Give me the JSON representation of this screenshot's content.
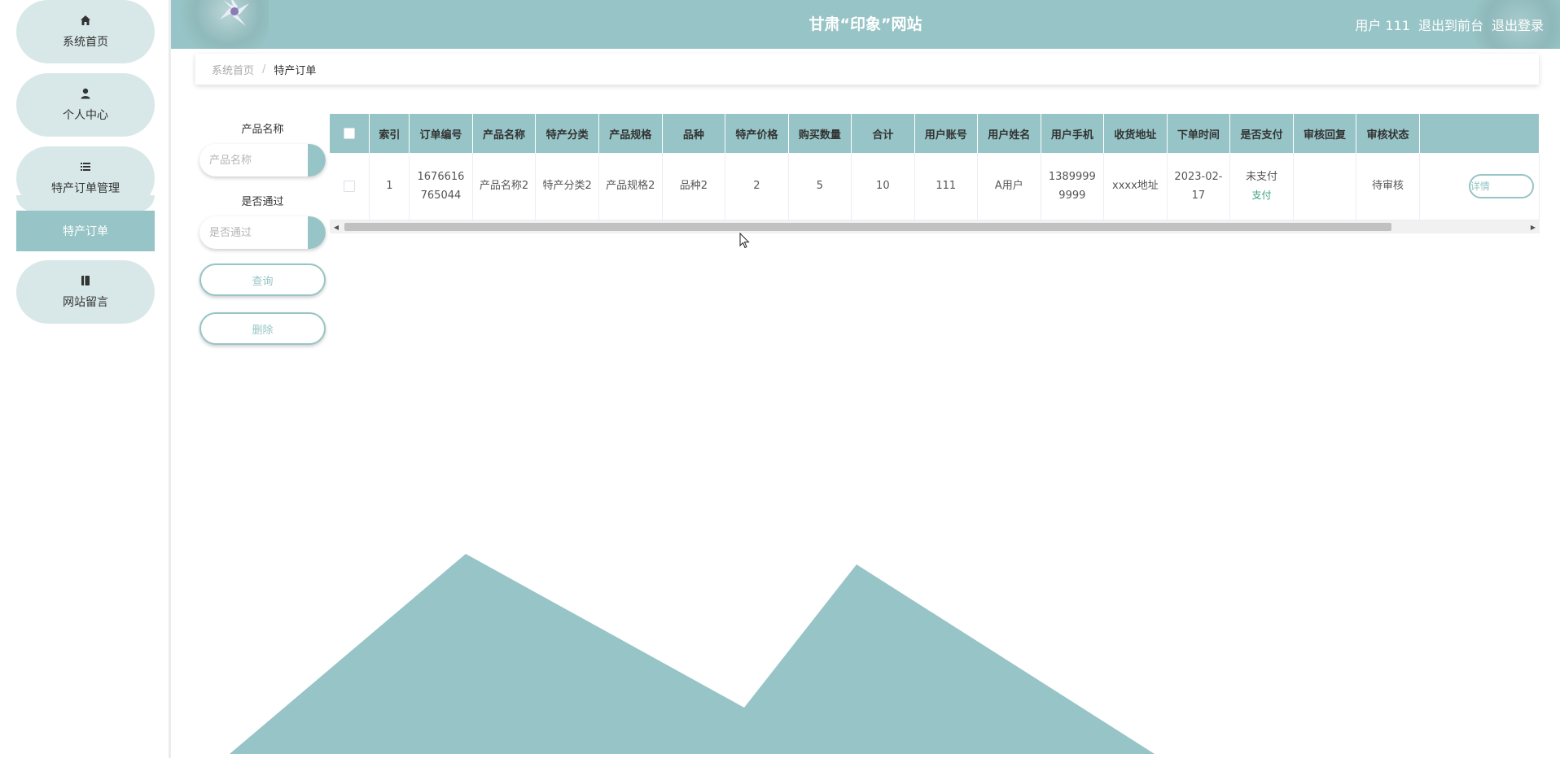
{
  "header": {
    "title": "甘肃“印象”网站",
    "user_label": "用户 111",
    "back_front": "退出到前台",
    "logout": "退出登录"
  },
  "sidebar": {
    "items": [
      {
        "label": "系统首页",
        "icon": "home-icon"
      },
      {
        "label": "个人中心",
        "icon": "user-icon"
      },
      {
        "label": "特产订单管理",
        "icon": "list-icon"
      },
      {
        "label": "网站留言",
        "icon": "book-icon"
      }
    ],
    "sub_item": "特产订单"
  },
  "breadcrumb": {
    "home": "系统首页",
    "separator": "/",
    "current": "特产订单"
  },
  "search": {
    "product_label": "产品名称",
    "product_placeholder": "产品名称",
    "pass_label": "是否通过",
    "pass_placeholder": "是否通过",
    "query_button": "查询",
    "delete_button": "删除"
  },
  "table": {
    "columns": [
      "索引",
      "订单编号",
      "产品名称",
      "特产分类",
      "产品规格",
      "品种",
      "特产价格",
      "购买数量",
      "合计",
      "用户账号",
      "用户姓名",
      "用户手机",
      "收货地址",
      "下单时间",
      "是否支付",
      "审核回复",
      "审核状态"
    ],
    "rows": [
      {
        "index": "1",
        "order_no": "1676616765044",
        "product_name": "产品名称2",
        "category": "特产分类2",
        "spec": "产品规格2",
        "variety": "品种2",
        "price": "2",
        "quantity": "5",
        "total": "10",
        "account": "111",
        "user_name": "A用户",
        "phone": "13899999999",
        "address": "xxxx地址",
        "order_time": "2023-02-17",
        "paid": "未支付",
        "pay_action": "支付",
        "review_reply": "",
        "review_status": "待审核",
        "detail_button": "详情"
      }
    ]
  },
  "colors": {
    "accent": "#97c4c6",
    "pill": "#d8e8e8",
    "pay_link": "#3aa17e"
  }
}
